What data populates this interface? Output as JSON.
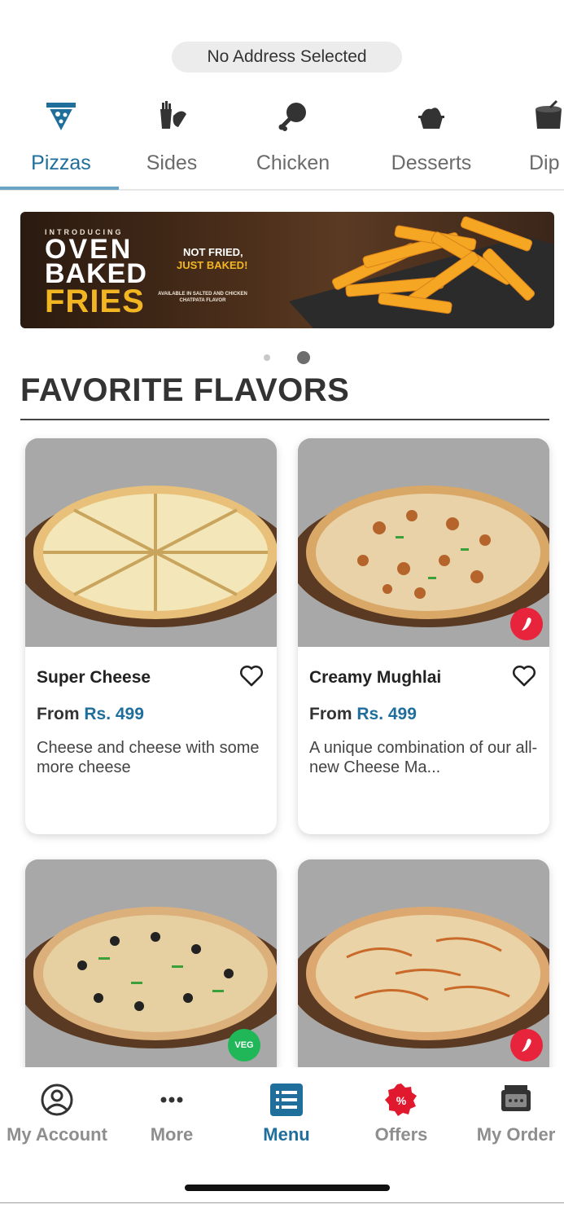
{
  "header": {
    "address_label": "No Address Selected"
  },
  "categories": [
    {
      "label": "Pizzas",
      "icon": "pizza-slice-icon",
      "active": true
    },
    {
      "label": "Sides",
      "icon": "sides-icon"
    },
    {
      "label": "Chicken",
      "icon": "chicken-leg-icon"
    },
    {
      "label": "Desserts",
      "icon": "dessert-icon"
    },
    {
      "label": "Dip",
      "icon": "dip-cup-icon"
    }
  ],
  "banner": {
    "introducing": "INTRODUCING",
    "line1": "OVEN",
    "line2": "BAKED",
    "line3": "FRIES",
    "tag1": "NOT FRIED,",
    "tag2": "JUST BAKED!",
    "availability": "AVAILABLE IN SALTED AND CHICKEN CHATPATA FLAVOR"
  },
  "carousel": {
    "active_index": 2,
    "count": 2
  },
  "section": {
    "title": "FAVORITE FLAVORS"
  },
  "products": [
    {
      "name": "Super Cheese",
      "price_prefix": "From",
      "price": "Rs. 499",
      "description": "Cheese and cheese with some more cheese",
      "badge": ""
    },
    {
      "name": "Creamy Mughlai",
      "price_prefix": "From",
      "price": "Rs. 499",
      "description": "A unique combination of our all-new Cheese Ma...",
      "badge": "spicy"
    },
    {
      "name": "",
      "badge": "veg",
      "badge_label": "VEG"
    },
    {
      "name": "",
      "badge": "spicy"
    }
  ],
  "nav": [
    {
      "label": "My Account",
      "icon": "account-icon"
    },
    {
      "label": "More",
      "icon": "more-dots-icon"
    },
    {
      "label": "Menu",
      "icon": "menu-list-icon",
      "active": true
    },
    {
      "label": "Offers",
      "icon": "offers-badge-icon"
    },
    {
      "label": "My Order",
      "icon": "order-box-icon"
    }
  ],
  "colors": {
    "accent": "#1f6e9c",
    "spicy": "#e8243c",
    "veg": "#20b759",
    "offers": "#e0192e"
  }
}
